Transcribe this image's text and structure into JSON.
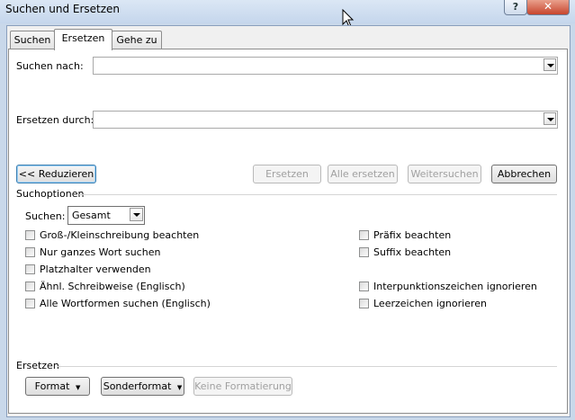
{
  "window": {
    "title": "Suchen und Ersetzen",
    "help": "?",
    "close": "✕"
  },
  "tabs": [
    {
      "label": "Suchen"
    },
    {
      "label": "Ersetzen"
    },
    {
      "label": "Gehe zu"
    }
  ],
  "search": {
    "label": "Suchen nach:",
    "value": ""
  },
  "replace": {
    "label": "Ersetzen durch:",
    "value": ""
  },
  "buttons": {
    "reduce": "<< Reduzieren",
    "replace": "Ersetzen",
    "replace_all": "Alle ersetzen",
    "find_next": "Weitersuchen",
    "cancel": "Abbrechen"
  },
  "options": {
    "heading": "Suchoptionen",
    "scope_label": "Suchen:",
    "scope_value": "Gesamt",
    "left": [
      "Groß-/Kleinschreibung beachten",
      "Nur ganzes Wort suchen",
      "Platzhalter verwenden",
      "Ähnl. Schreibweise (Englisch)",
      "Alle Wortformen suchen (Englisch)"
    ],
    "right": [
      "Präfix beachten",
      "Suffix beachten",
      "Interpunktionszeichen ignorieren",
      "Leerzeichen ignorieren"
    ]
  },
  "replace_section": {
    "heading": "Ersetzen",
    "format": "Format",
    "special": "Sonderformat",
    "no_format": "Keine Formatierung"
  }
}
